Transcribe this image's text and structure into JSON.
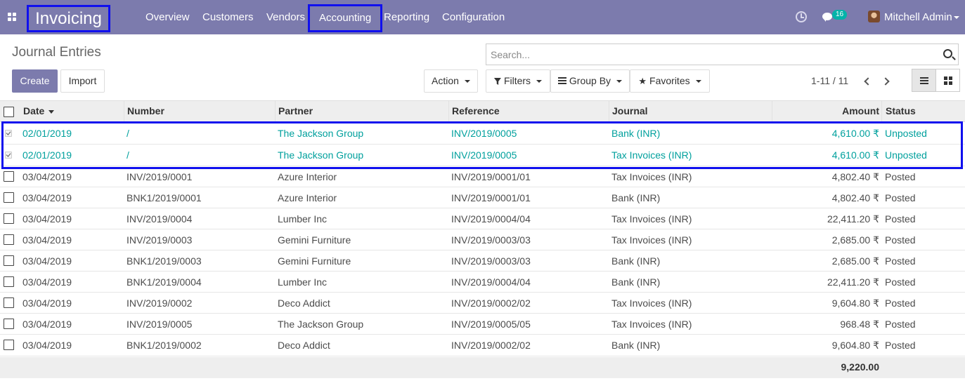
{
  "navbar": {
    "app_name": "Invoicing",
    "menu": [
      "Overview",
      "Customers",
      "Vendors",
      "Accounting",
      "Reporting",
      "Configuration"
    ],
    "badge_count": "16",
    "user": "Mitchell Admin",
    "color": "#7c7bad",
    "highlight_color": "#1010ee"
  },
  "control": {
    "title": "Journal Entries",
    "search_placeholder": "Search...",
    "create_label": "Create",
    "import_label": "Import",
    "action_label": "Action",
    "filters_label": "Filters",
    "groupby_label": "Group By",
    "favorites_label": "Favorites",
    "pager": "1-11 / 11"
  },
  "table": {
    "columns": [
      "Date",
      "Number",
      "Partner",
      "Reference",
      "Journal",
      "Amount",
      "Status"
    ],
    "rows": [
      {
        "date": "02/01/2019",
        "number": "/",
        "partner": "The Jackson Group",
        "reference": "INV/2019/0005",
        "journal": "Bank (INR)",
        "amount": "4,610.00 ₹",
        "status": "Unposted",
        "selected": true
      },
      {
        "date": "02/01/2019",
        "number": "/",
        "partner": "The Jackson Group",
        "reference": "INV/2019/0005",
        "journal": "Tax Invoices (INR)",
        "amount": "4,610.00 ₹",
        "status": "Unposted",
        "selected": true
      },
      {
        "date": "03/04/2019",
        "number": "INV/2019/0001",
        "partner": "Azure Interior",
        "reference": "INV/2019/0001/01",
        "journal": "Tax Invoices (INR)",
        "amount": "4,802.40 ₹",
        "status": "Posted",
        "selected": false
      },
      {
        "date": "03/04/2019",
        "number": "BNK1/2019/0001",
        "partner": "Azure Interior",
        "reference": "INV/2019/0001/01",
        "journal": "Bank (INR)",
        "amount": "4,802.40 ₹",
        "status": "Posted",
        "selected": false
      },
      {
        "date": "03/04/2019",
        "number": "INV/2019/0004",
        "partner": "Lumber Inc",
        "reference": "INV/2019/0004/04",
        "journal": "Tax Invoices (INR)",
        "amount": "22,411.20 ₹",
        "status": "Posted",
        "selected": false
      },
      {
        "date": "03/04/2019",
        "number": "INV/2019/0003",
        "partner": "Gemini Furniture",
        "reference": "INV/2019/0003/03",
        "journal": "Tax Invoices (INR)",
        "amount": "2,685.00 ₹",
        "status": "Posted",
        "selected": false
      },
      {
        "date": "03/04/2019",
        "number": "BNK1/2019/0003",
        "partner": "Gemini Furniture",
        "reference": "INV/2019/0003/03",
        "journal": "Bank (INR)",
        "amount": "2,685.00 ₹",
        "status": "Posted",
        "selected": false
      },
      {
        "date": "03/04/2019",
        "number": "BNK1/2019/0004",
        "partner": "Lumber Inc",
        "reference": "INV/2019/0004/04",
        "journal": "Bank (INR)",
        "amount": "22,411.20 ₹",
        "status": "Posted",
        "selected": false
      },
      {
        "date": "03/04/2019",
        "number": "INV/2019/0002",
        "partner": "Deco Addict",
        "reference": "INV/2019/0002/02",
        "journal": "Tax Invoices (INR)",
        "amount": "9,604.80 ₹",
        "status": "Posted",
        "selected": false
      },
      {
        "date": "03/04/2019",
        "number": "INV/2019/0005",
        "partner": "The Jackson Group",
        "reference": "INV/2019/0005/05",
        "journal": "Tax Invoices (INR)",
        "amount": "968.48 ₹",
        "status": "Posted",
        "selected": false
      },
      {
        "date": "03/04/2019",
        "number": "BNK1/2019/0002",
        "partner": "Deco Addict",
        "reference": "INV/2019/0002/02",
        "journal": "Bank (INR)",
        "amount": "9,604.80 ₹",
        "status": "Posted",
        "selected": false
      }
    ],
    "total": "9,220.00",
    "selected_color": "#00a09d"
  }
}
